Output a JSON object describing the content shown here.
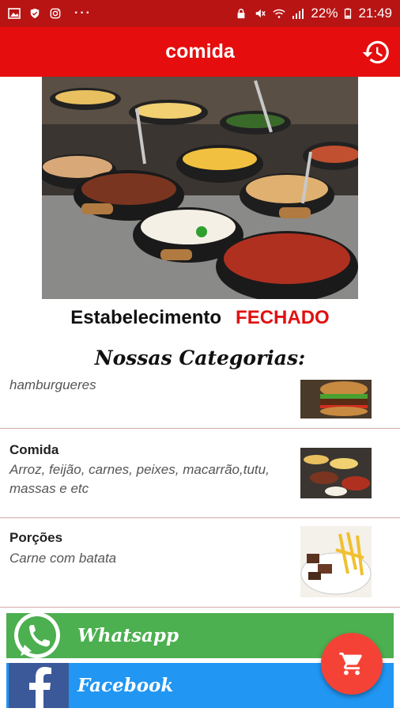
{
  "status_bar": {
    "battery": "22%",
    "time": "21:49",
    "overflow": "···"
  },
  "app_bar": {
    "title": "comida"
  },
  "store_status": {
    "label": "Estabelecimento",
    "state": "FECHADO"
  },
  "categories_heading": "Nossas Categorias:",
  "categories": [
    {
      "title": "",
      "description": "hamburgueres"
    },
    {
      "title": "Comida",
      "description": "Arroz, feijão, carnes, peixes, macarrão,tutu, massas e etc"
    },
    {
      "title": "Porções",
      "description": "Carne com batata"
    }
  ],
  "social": {
    "whatsapp": "Whatsapp",
    "facebook": "Facebook"
  },
  "colors": {
    "status_bar": "#b81414",
    "app_bar": "#e50d0d",
    "closed": "#e01111",
    "whatsapp": "#4caf50",
    "facebook": "#2196f3",
    "fab": "#f44336"
  }
}
